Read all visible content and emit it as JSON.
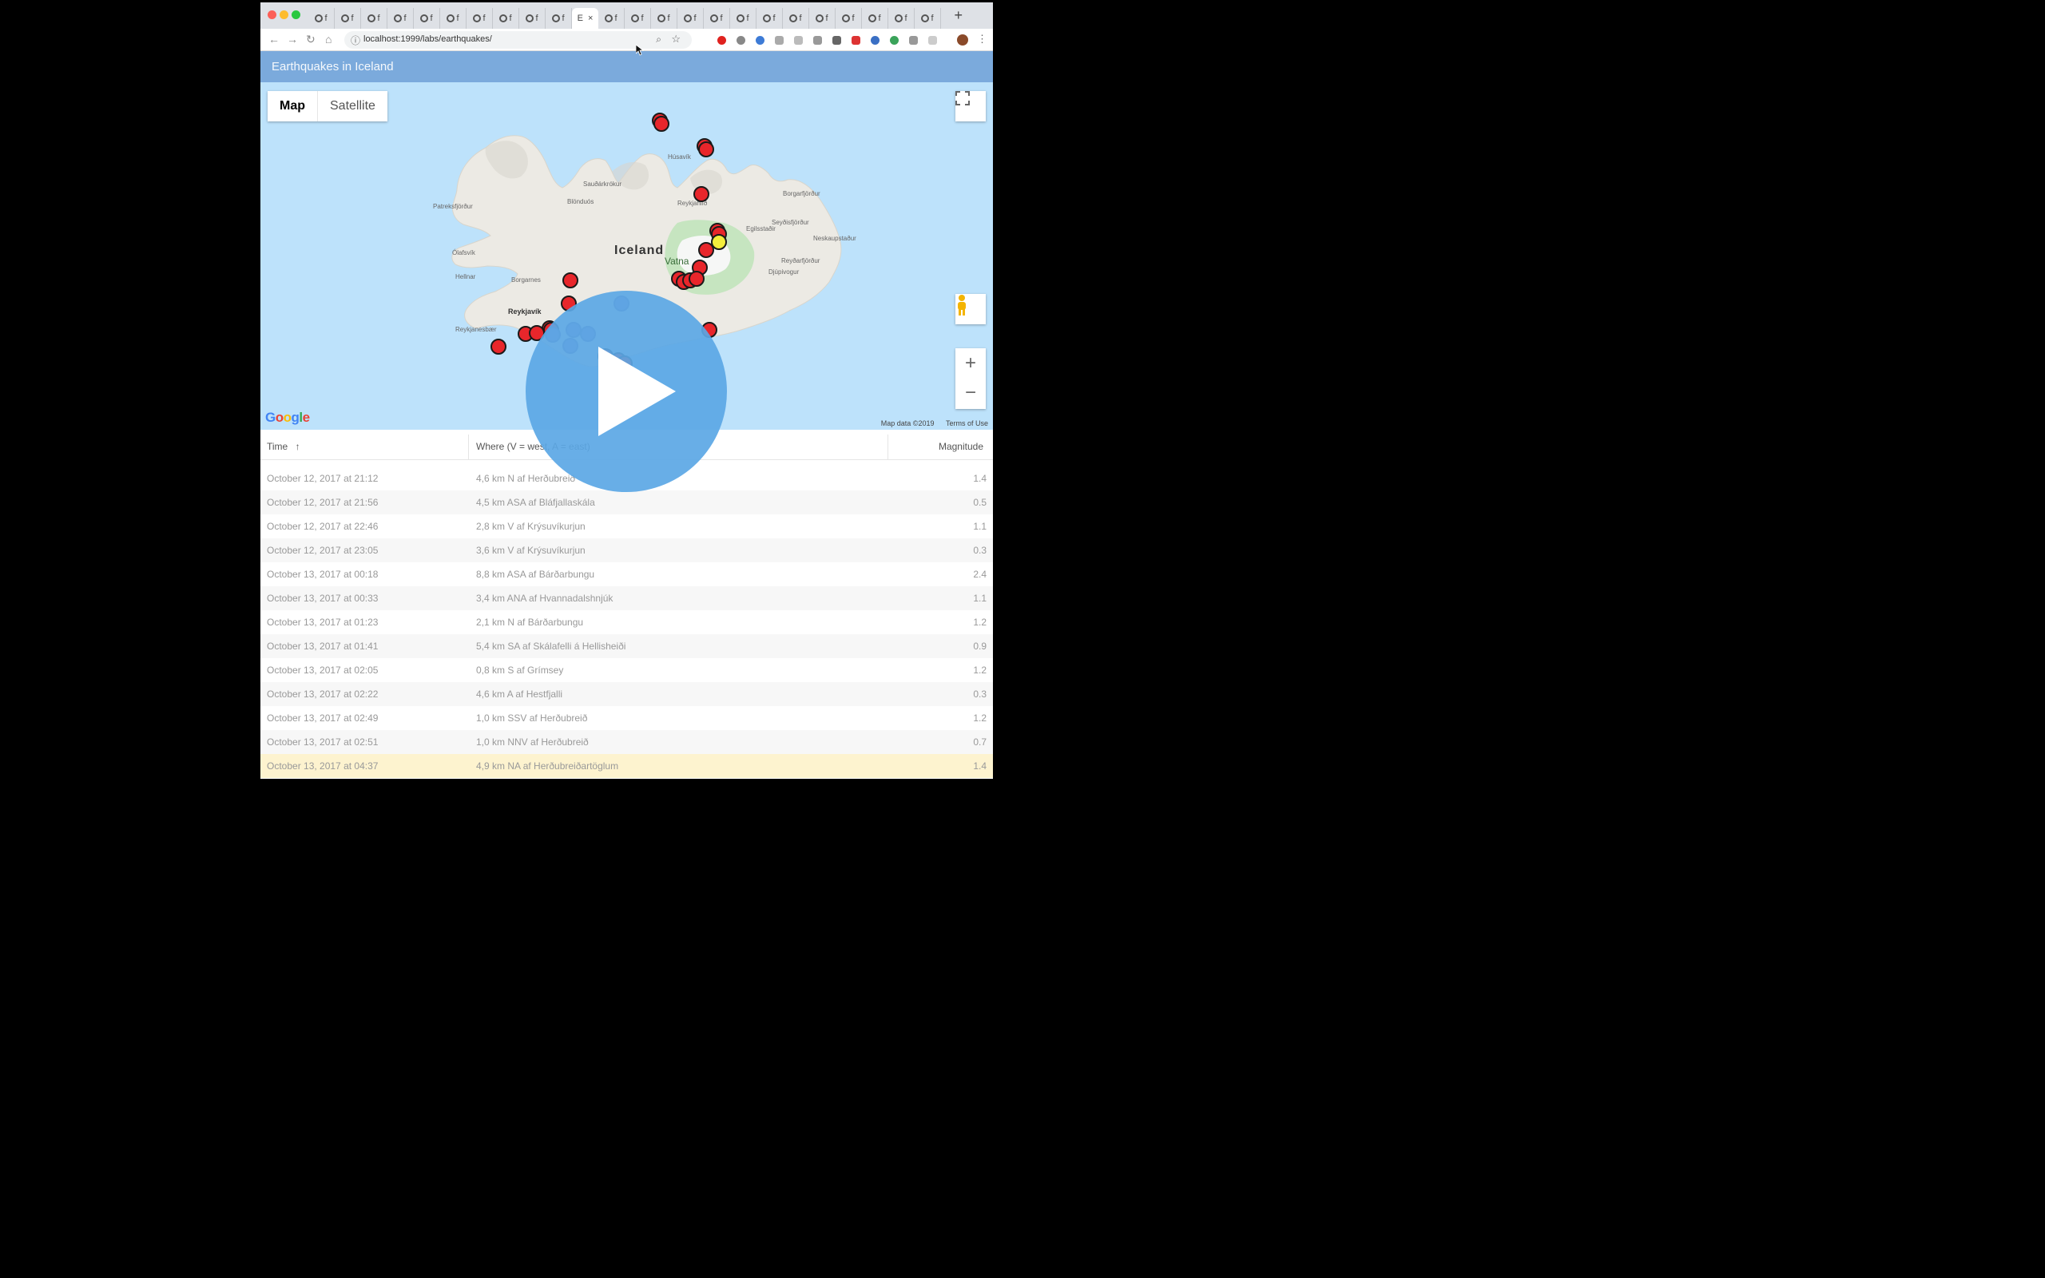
{
  "browser": {
    "url": "localhost:1999/labs/earthquakes/",
    "active_tab_label": "E",
    "tab_labels": [
      "f",
      "f",
      "f",
      "f",
      "f",
      "f",
      "f",
      "f",
      "f",
      "f",
      "E",
      "f",
      "f",
      "f",
      "f",
      "f",
      "f",
      "f",
      "f",
      "f",
      "f",
      "f",
      "f",
      "f"
    ],
    "new_tab_label": "+",
    "colors": {
      "close": "#fc5f57",
      "minimize": "#fdbc2e",
      "maximize": "#28c840"
    }
  },
  "app": {
    "title": "Earthquakes in Iceland",
    "header_color": "#7baadc"
  },
  "map": {
    "type_buttons": [
      "Map",
      "Satellite"
    ],
    "active_type": "Map",
    "country_label": "Iceland",
    "place_labels": [
      "Húsavík",
      "Reykjahlíð",
      "Sauðárkrókur",
      "Blönduós",
      "Patreksfjörður",
      "Ólafsvík",
      "Hellnar",
      "Borgarnes",
      "Reykjavík",
      "Reykjanesbær",
      "Egilsstaðir",
      "Borgarfjörður",
      "Seyðisfjörður",
      "Neskaupstaður",
      "Reyðarfjörður",
      "Djúpivogur",
      "Vatna",
      "Höfn"
    ],
    "attribution": [
      "Map data ©2019",
      "Terms of Use"
    ],
    "logo": "Google",
    "controls": [
      "fullscreen-icon",
      "pegman-icon",
      "zoom-in-icon",
      "zoom-out-icon"
    ]
  },
  "table": {
    "columns": {
      "time": "Time",
      "where": "Where (V = west, A = east)",
      "magnitude": "Magnitude"
    },
    "sort_indicator": "↑",
    "rows": [
      {
        "time": "October 12, 2017 at 21:12",
        "where": "4,6 km N af Herðubreið",
        "mag": "1.4"
      },
      {
        "time": "October 12, 2017 at 21:56",
        "where": "4,5 km ASA af Bláfjallaskála",
        "mag": "0.5"
      },
      {
        "time": "October 12, 2017 at 22:46",
        "where": "2,8 km V af Krýsuvíkurjun",
        "mag": "1.1"
      },
      {
        "time": "October 12, 2017 at 23:05",
        "where": "3,6 km V af Krýsuvíkurjun",
        "mag": "0.3"
      },
      {
        "time": "October 13, 2017 at 00:18",
        "where": "8,8 km ASA af Bárðarbungu",
        "mag": "2.4"
      },
      {
        "time": "October 13, 2017 at 00:33",
        "where": "3,4 km ANA af Hvannadalshnjúk",
        "mag": "1.1"
      },
      {
        "time": "October 13, 2017 at 01:23",
        "where": "2,1 km N af Bárðarbungu",
        "mag": "1.2"
      },
      {
        "time": "October 13, 2017 at 01:41",
        "where": "5,4 km SA af Skálafelli á Hellisheiði",
        "mag": "0.9"
      },
      {
        "time": "October 13, 2017 at 02:05",
        "where": "0,8 km S af Grímsey",
        "mag": "1.2"
      },
      {
        "time": "October 13, 2017 at 02:22",
        "where": "4,6 km A af Hestfjalli",
        "mag": "0.3"
      },
      {
        "time": "October 13, 2017 at 02:49",
        "where": "1,0 km SSV af Herðubreið",
        "mag": "1.2"
      },
      {
        "time": "October 13, 2017 at 02:51",
        "where": "1,0 km NNV af Herðubreið",
        "mag": "0.7"
      },
      {
        "time": "October 13, 2017 at 04:37",
        "where": "4,9 km NA af Herðubreiðartöglum",
        "mag": "1.4",
        "highlighted": true
      }
    ]
  },
  "overlay": {
    "play_icon": "play-icon",
    "color": "#5ba7e5"
  },
  "markers": {
    "colors": {
      "default": "#e8262b",
      "selected": "#f4ee3c",
      "faded": "#8a84c4"
    }
  }
}
